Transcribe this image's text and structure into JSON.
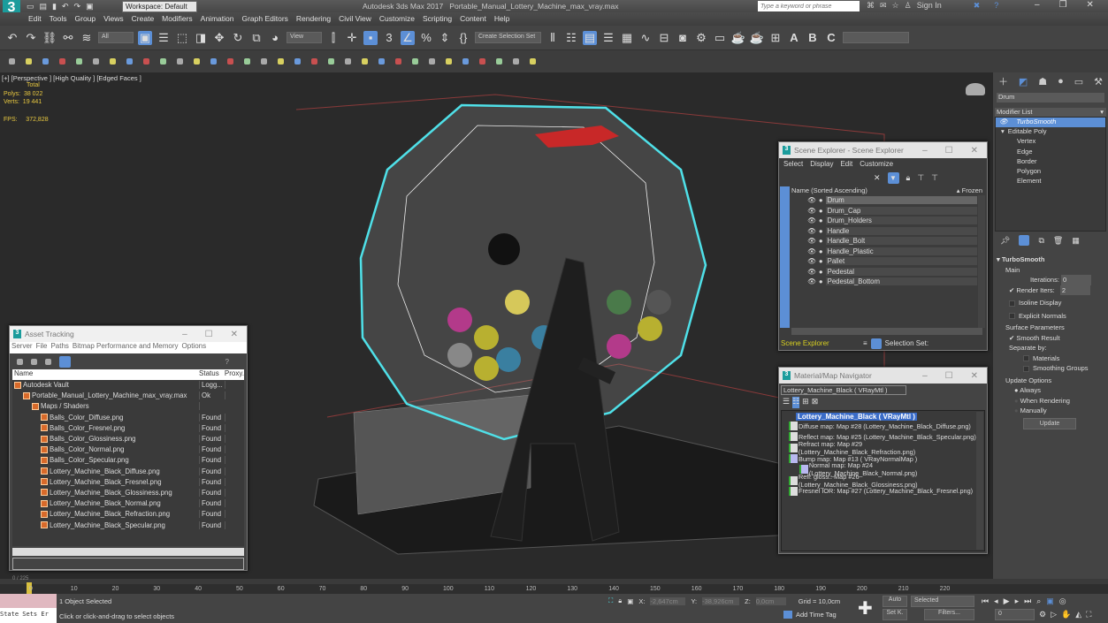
{
  "app": {
    "title": "Autodesk 3ds Max 2017",
    "file": "Portable_Manual_Lottery_Machine_max_vray.max",
    "workspace": "Workspace: Default",
    "search_placeholder": "Type a keyword or phrase",
    "sign_in": "Sign In"
  },
  "menu": [
    "Edit",
    "Tools",
    "Group",
    "Views",
    "Create",
    "Modifiers",
    "Animation",
    "Graph Editors",
    "Rendering",
    "Civil View",
    "Customize",
    "Scripting",
    "Content",
    "Help"
  ],
  "toolbar": {
    "filter": "All",
    "ref_coord": "View",
    "selection_set": "Create Selection Set"
  },
  "viewport": {
    "label": "[+] [Perspective ] [High Quality ] [Edged Faces ]",
    "stats": {
      "total": "Total",
      "polys_label": "Polys:",
      "polys": "38 022",
      "verts_label": "Verts:",
      "verts": "19 441",
      "fps_label": "FPS:",
      "fps": "372,828"
    }
  },
  "asset_tracking": {
    "title": "Asset Tracking",
    "menu": [
      "Server",
      "File",
      "Paths",
      "Bitmap Performance and Memory",
      "Options"
    ],
    "columns": [
      "Name",
      "Status",
      "Proxy."
    ],
    "rows": [
      {
        "name": "Autodesk Vault",
        "status": "Logg...",
        "level": 0
      },
      {
        "name": "Portable_Manual_Lottery_Machine_max_vray.max",
        "status": "Ok",
        "level": 1
      },
      {
        "name": "Maps / Shaders",
        "status": "",
        "level": 2
      },
      {
        "name": "Balls_Color_Diffuse.png",
        "status": "Found",
        "level": 3
      },
      {
        "name": "Balls_Color_Fresnel.png",
        "status": "Found",
        "level": 3
      },
      {
        "name": "Balls_Color_Glossiness.png",
        "status": "Found",
        "level": 3
      },
      {
        "name": "Balls_Color_Normal.png",
        "status": "Found",
        "level": 3
      },
      {
        "name": "Balls_Color_Specular.png",
        "status": "Found",
        "level": 3
      },
      {
        "name": "Lottery_Machine_Black_Diffuse.png",
        "status": "Found",
        "level": 3
      },
      {
        "name": "Lottery_Machine_Black_Fresnel.png",
        "status": "Found",
        "level": 3
      },
      {
        "name": "Lottery_Machine_Black_Glossiness.png",
        "status": "Found",
        "level": 3
      },
      {
        "name": "Lottery_Machine_Black_Normal.png",
        "status": "Found",
        "level": 3
      },
      {
        "name": "Lottery_Machine_Black_Refraction.png",
        "status": "Found",
        "level": 3
      },
      {
        "name": "Lottery_Machine_Black_Specular.png",
        "status": "Found",
        "level": 3
      }
    ]
  },
  "scene_explorer": {
    "title": "Scene Explorer - Scene Explorer",
    "menu": [
      "Select",
      "Display",
      "Edit",
      "Customize"
    ],
    "column": "Name (Sorted Ascending)",
    "frozen": "▴ Frozen",
    "objects": [
      "Drum",
      "Drum_Cap",
      "Drum_Holders",
      "Handle",
      "Handle_Bolt",
      "Handle_Plastic",
      "Pallet",
      "Pedestal",
      "Pedestal_Bottom"
    ],
    "footer_name": "Scene Explorer",
    "selection_set": "Selection Set:"
  },
  "material_nav": {
    "title": "Material/Map Navigator",
    "field": "Lottery_Machine_Black  ( VRayMtl )",
    "root": "Lottery_Machine_Black  ( VRayMtl )",
    "maps": [
      "Diffuse map: Map #28 (Lottery_Machine_Black_Diffuse.png)",
      "Reflect map: Map #25 (Lottery_Machine_Black_Specular.png)",
      "Refract map: Map #29 (Lottery_Machine_Black_Refraction.png)",
      "Bump map: Map #13  ( VRayNormalMap )",
      "Normal map: Map #24 (Lottery_Machine_Black_Normal.png)",
      "Refl. gloss.: Map #26 (Lottery_Machine_Black_Glossiness.png)",
      "Fresnel IOR: Map #27 (Lottery_Machine_Black_Fresnel.png)"
    ]
  },
  "command_panel": {
    "object_name": "Drum",
    "modifier_list": "Modifier List",
    "stack": [
      "TurboSmooth",
      "Editable Poly",
      "Vertex",
      "Edge",
      "Border",
      "Polygon",
      "Element"
    ],
    "turbosmooth": {
      "title": "TurboSmooth",
      "main": "Main",
      "iterations_label": "Iterations:",
      "iterations": "0",
      "render_iters_label": "Render Iters:",
      "render_iters": "2",
      "render_iters_checked": true,
      "isoline": "Isoline Display",
      "explicit_normals": "Explicit Normals",
      "surface": "Surface Parameters",
      "smooth_result": "Smooth Result",
      "separate_by": "Separate by:",
      "materials": "Materials",
      "smoothing_groups": "Smoothing Groups",
      "update_options": "Update Options",
      "always": "Always",
      "when_rendering": "When Rendering",
      "manually": "Manually",
      "update": "Update"
    }
  },
  "timeline": {
    "ticks": [
      "0",
      "10",
      "20",
      "30",
      "40",
      "50",
      "60",
      "70",
      "80",
      "90",
      "100",
      "110",
      "120",
      "130",
      "140",
      "150",
      "160",
      "170",
      "180",
      "190",
      "200",
      "210",
      "220"
    ],
    "frame": "0 / 225"
  },
  "status": {
    "state_sets": "State Sets Er",
    "selected": "1 Object Selected",
    "prompt": "Click or click-and-drag to select objects",
    "x_label": "X:",
    "x": "-2,647cm",
    "y_label": "Y:",
    "y": "-38,926cm",
    "z_label": "Z:",
    "z": "0,0cm",
    "grid": "Grid = 10,0cm",
    "add_time_tag": "Add Time Tag",
    "auto": "Auto",
    "set_key": "Set K.",
    "selected_dd": "Selected",
    "filters": "Filters...",
    "frame_field": "0"
  },
  "colors": {
    "accent": "#5c8fd6",
    "selection_wire": "#4fe0e8",
    "viewport_bg": "#2a2a2a"
  }
}
